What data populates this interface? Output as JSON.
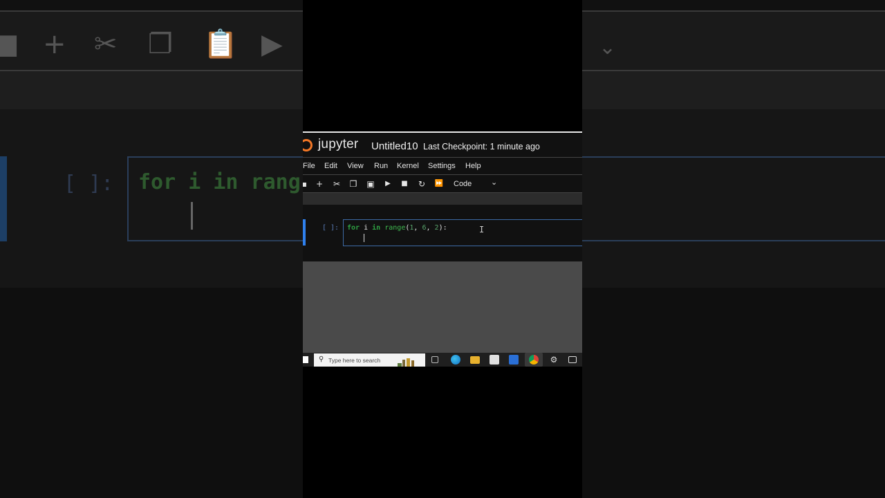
{
  "background": {
    "prompt": "[ ]:",
    "code": "for i in rang"
  },
  "jupyter": {
    "logo_text": "jupyter",
    "notebook_title": "Untitled10",
    "checkpoint": "Last Checkpoint: 1 minute ago",
    "menu": [
      "File",
      "Edit",
      "View",
      "Run",
      "Kernel",
      "Settings",
      "Help"
    ],
    "toolbar": {
      "cell_type": "Code"
    },
    "cell": {
      "prompt": "[ ]:",
      "code_tokens": [
        "for",
        " ",
        "i",
        " ",
        "in",
        " ",
        "range",
        "(",
        "1",
        ", ",
        "6",
        ", ",
        "2",
        "):"
      ]
    }
  },
  "taskbar": {
    "search_placeholder": "Type here to search"
  },
  "colors": {
    "jupyter_orange": "#f37726",
    "active_cell_blue": "#2f80ed",
    "keyword_green": "#2ea043"
  }
}
